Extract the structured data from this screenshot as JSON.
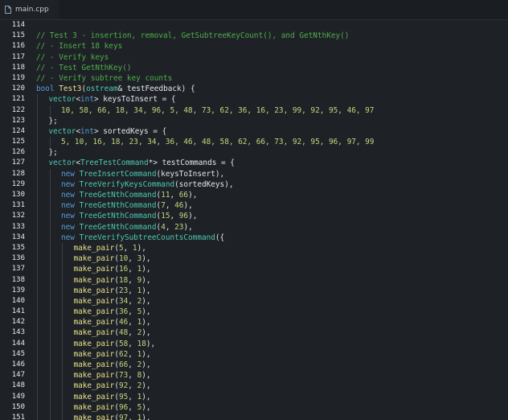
{
  "tab": {
    "label": "main.cpp",
    "icon": "file-icon"
  },
  "colors": {
    "background": "#1e2126",
    "comment": "#4fae4a",
    "keyword": "#569cd6",
    "function": "#e8e28c",
    "type": "#4ec9b0",
    "number": "#c2d87e",
    "text": "#e3e6ea"
  },
  "lines": [
    {
      "n": "114",
      "indent": 0,
      "tokens": []
    },
    {
      "n": "115",
      "indent": 0,
      "tokens": [
        {
          "t": "cm",
          "v": "// Test 3 - insertion, removal, GetSubtreeKeyCount(), and GetNthKey()"
        }
      ]
    },
    {
      "n": "116",
      "indent": 0,
      "tokens": [
        {
          "t": "cm",
          "v": "// - Insert 18 keys"
        }
      ]
    },
    {
      "n": "117",
      "indent": 0,
      "tokens": [
        {
          "t": "cm",
          "v": "// - Verify keys"
        }
      ]
    },
    {
      "n": "118",
      "indent": 0,
      "tokens": [
        {
          "t": "cm",
          "v": "// - Test GetNthKey()"
        }
      ]
    },
    {
      "n": "119",
      "indent": 0,
      "tokens": [
        {
          "t": "cm",
          "v": "// - Verify subtree key counts"
        }
      ]
    },
    {
      "n": "120",
      "indent": 0,
      "tokens": [
        {
          "t": "kw",
          "v": "bool "
        },
        {
          "t": "fn",
          "v": "Test3"
        },
        {
          "t": "pu",
          "v": "("
        },
        {
          "t": "ty",
          "v": "ostream"
        },
        {
          "t": "pu",
          "v": "& testFeedback) {"
        }
      ]
    },
    {
      "n": "121",
      "indent": 1,
      "tokens": [
        {
          "t": "ty",
          "v": "vector"
        },
        {
          "t": "pu",
          "v": "<"
        },
        {
          "t": "kw",
          "v": "int"
        },
        {
          "t": "pu",
          "v": "> keysToInsert = {"
        }
      ]
    },
    {
      "n": "122",
      "indent": 2,
      "tokens": [
        {
          "t": "nu",
          "v": "10, 58, 66, 18, 34, 96, 5, 48, 73, 62, 36, 16, 23, 99, 92, 95, 46, 97"
        }
      ]
    },
    {
      "n": "123",
      "indent": 1,
      "tokens": [
        {
          "t": "pu",
          "v": "};"
        }
      ]
    },
    {
      "n": "124",
      "indent": 1,
      "tokens": [
        {
          "t": "ty",
          "v": "vector"
        },
        {
          "t": "pu",
          "v": "<"
        },
        {
          "t": "kw",
          "v": "int"
        },
        {
          "t": "pu",
          "v": "> sortedKeys = {"
        }
      ]
    },
    {
      "n": "125",
      "indent": 2,
      "tokens": [
        {
          "t": "nu",
          "v": "5, 10, 16, 18, 23, 34, 36, 46, 48, 58, 62, 66, 73, 92, 95, 96, 97, 99"
        }
      ]
    },
    {
      "n": "126",
      "indent": 1,
      "tokens": [
        {
          "t": "pu",
          "v": "};"
        }
      ]
    },
    {
      "n": "127",
      "indent": 1,
      "tokens": [
        {
          "t": "ty",
          "v": "vector"
        },
        {
          "t": "pu",
          "v": "<"
        },
        {
          "t": "ty",
          "v": "TreeTestCommand"
        },
        {
          "t": "pu",
          "v": "*> testCommands = {"
        }
      ]
    },
    {
      "n": "128",
      "indent": 2,
      "tokens": [
        {
          "t": "kw",
          "v": "new "
        },
        {
          "t": "ty",
          "v": "TreeInsertCommand"
        },
        {
          "t": "pu",
          "v": "(keysToInsert),"
        }
      ]
    },
    {
      "n": "129",
      "indent": 2,
      "tokens": [
        {
          "t": "kw",
          "v": "new "
        },
        {
          "t": "ty",
          "v": "TreeVerifyKeysCommand"
        },
        {
          "t": "pu",
          "v": "(sortedKeys),"
        }
      ]
    },
    {
      "n": "130",
      "indent": 2,
      "tokens": [
        {
          "t": "kw",
          "v": "new "
        },
        {
          "t": "ty",
          "v": "TreeGetNthCommand"
        },
        {
          "t": "pu",
          "v": "("
        },
        {
          "t": "nu",
          "v": "11"
        },
        {
          "t": "pu",
          "v": ", "
        },
        {
          "t": "nu",
          "v": "66"
        },
        {
          "t": "pu",
          "v": "),"
        }
      ]
    },
    {
      "n": "131",
      "indent": 2,
      "tokens": [
        {
          "t": "kw",
          "v": "new "
        },
        {
          "t": "ty",
          "v": "TreeGetNthCommand"
        },
        {
          "t": "pu",
          "v": "("
        },
        {
          "t": "nu",
          "v": "7"
        },
        {
          "t": "pu",
          "v": ", "
        },
        {
          "t": "nu",
          "v": "46"
        },
        {
          "t": "pu",
          "v": "),"
        }
      ]
    },
    {
      "n": "132",
      "indent": 2,
      "tokens": [
        {
          "t": "kw",
          "v": "new "
        },
        {
          "t": "ty",
          "v": "TreeGetNthCommand"
        },
        {
          "t": "pu",
          "v": "("
        },
        {
          "t": "nu",
          "v": "15"
        },
        {
          "t": "pu",
          "v": ", "
        },
        {
          "t": "nu",
          "v": "96"
        },
        {
          "t": "pu",
          "v": "),"
        }
      ]
    },
    {
      "n": "133",
      "indent": 2,
      "tokens": [
        {
          "t": "kw",
          "v": "new "
        },
        {
          "t": "ty",
          "v": "TreeGetNthCommand"
        },
        {
          "t": "pu",
          "v": "("
        },
        {
          "t": "nu",
          "v": "4"
        },
        {
          "t": "pu",
          "v": ", "
        },
        {
          "t": "nu",
          "v": "23"
        },
        {
          "t": "pu",
          "v": "),"
        }
      ]
    },
    {
      "n": "134",
      "indent": 2,
      "tokens": [
        {
          "t": "kw",
          "v": "new "
        },
        {
          "t": "ty",
          "v": "TreeVerifySubtreeCountsCommand"
        },
        {
          "t": "pu",
          "v": "({"
        }
      ]
    },
    {
      "n": "135",
      "indent": 3,
      "tokens": [
        {
          "t": "fn",
          "v": "make_pair"
        },
        {
          "t": "pu",
          "v": "("
        },
        {
          "t": "nu",
          "v": "5"
        },
        {
          "t": "pu",
          "v": ", "
        },
        {
          "t": "nu",
          "v": "1"
        },
        {
          "t": "pu",
          "v": "),"
        }
      ]
    },
    {
      "n": "136",
      "indent": 3,
      "tokens": [
        {
          "t": "fn",
          "v": "make_pair"
        },
        {
          "t": "pu",
          "v": "("
        },
        {
          "t": "nu",
          "v": "10"
        },
        {
          "t": "pu",
          "v": ", "
        },
        {
          "t": "nu",
          "v": "3"
        },
        {
          "t": "pu",
          "v": "),"
        }
      ]
    },
    {
      "n": "137",
      "indent": 3,
      "tokens": [
        {
          "t": "fn",
          "v": "make_pair"
        },
        {
          "t": "pu",
          "v": "("
        },
        {
          "t": "nu",
          "v": "16"
        },
        {
          "t": "pu",
          "v": ", "
        },
        {
          "t": "nu",
          "v": "1"
        },
        {
          "t": "pu",
          "v": "),"
        }
      ]
    },
    {
      "n": "138",
      "indent": 3,
      "tokens": [
        {
          "t": "fn",
          "v": "make_pair"
        },
        {
          "t": "pu",
          "v": "("
        },
        {
          "t": "nu",
          "v": "18"
        },
        {
          "t": "pu",
          "v": ", "
        },
        {
          "t": "nu",
          "v": "9"
        },
        {
          "t": "pu",
          "v": "),"
        }
      ]
    },
    {
      "n": "139",
      "indent": 3,
      "tokens": [
        {
          "t": "fn",
          "v": "make_pair"
        },
        {
          "t": "pu",
          "v": "("
        },
        {
          "t": "nu",
          "v": "23"
        },
        {
          "t": "pu",
          "v": ", "
        },
        {
          "t": "nu",
          "v": "1"
        },
        {
          "t": "pu",
          "v": "),"
        }
      ]
    },
    {
      "n": "140",
      "indent": 3,
      "tokens": [
        {
          "t": "fn",
          "v": "make_pair"
        },
        {
          "t": "pu",
          "v": "("
        },
        {
          "t": "nu",
          "v": "34"
        },
        {
          "t": "pu",
          "v": ", "
        },
        {
          "t": "nu",
          "v": "2"
        },
        {
          "t": "pu",
          "v": "),"
        }
      ]
    },
    {
      "n": "141",
      "indent": 3,
      "tokens": [
        {
          "t": "fn",
          "v": "make_pair"
        },
        {
          "t": "pu",
          "v": "("
        },
        {
          "t": "nu",
          "v": "36"
        },
        {
          "t": "pu",
          "v": ", "
        },
        {
          "t": "nu",
          "v": "5"
        },
        {
          "t": "pu",
          "v": "),"
        }
      ]
    },
    {
      "n": "142",
      "indent": 3,
      "tokens": [
        {
          "t": "fn",
          "v": "make_pair"
        },
        {
          "t": "pu",
          "v": "("
        },
        {
          "t": "nu",
          "v": "46"
        },
        {
          "t": "pu",
          "v": ", "
        },
        {
          "t": "nu",
          "v": "1"
        },
        {
          "t": "pu",
          "v": "),"
        }
      ]
    },
    {
      "n": "143",
      "indent": 3,
      "tokens": [
        {
          "t": "fn",
          "v": "make_pair"
        },
        {
          "t": "pu",
          "v": "("
        },
        {
          "t": "nu",
          "v": "48"
        },
        {
          "t": "pu",
          "v": ", "
        },
        {
          "t": "nu",
          "v": "2"
        },
        {
          "t": "pu",
          "v": "),"
        }
      ]
    },
    {
      "n": "144",
      "indent": 3,
      "tokens": [
        {
          "t": "fn",
          "v": "make_pair"
        },
        {
          "t": "pu",
          "v": "("
        },
        {
          "t": "nu",
          "v": "58"
        },
        {
          "t": "pu",
          "v": ", "
        },
        {
          "t": "nu",
          "v": "18"
        },
        {
          "t": "pu",
          "v": "),"
        }
      ]
    },
    {
      "n": "145",
      "indent": 3,
      "tokens": [
        {
          "t": "fn",
          "v": "make_pair"
        },
        {
          "t": "pu",
          "v": "("
        },
        {
          "t": "nu",
          "v": "62"
        },
        {
          "t": "pu",
          "v": ", "
        },
        {
          "t": "nu",
          "v": "1"
        },
        {
          "t": "pu",
          "v": "),"
        }
      ]
    },
    {
      "n": "146",
      "indent": 3,
      "tokens": [
        {
          "t": "fn",
          "v": "make_pair"
        },
        {
          "t": "pu",
          "v": "("
        },
        {
          "t": "nu",
          "v": "66"
        },
        {
          "t": "pu",
          "v": ", "
        },
        {
          "t": "nu",
          "v": "2"
        },
        {
          "t": "pu",
          "v": "),"
        }
      ]
    },
    {
      "n": "147",
      "indent": 3,
      "tokens": [
        {
          "t": "fn",
          "v": "make_pair"
        },
        {
          "t": "pu",
          "v": "("
        },
        {
          "t": "nu",
          "v": "73"
        },
        {
          "t": "pu",
          "v": ", "
        },
        {
          "t": "nu",
          "v": "8"
        },
        {
          "t": "pu",
          "v": "),"
        }
      ]
    },
    {
      "n": "148",
      "indent": 3,
      "tokens": [
        {
          "t": "fn",
          "v": "make_pair"
        },
        {
          "t": "pu",
          "v": "("
        },
        {
          "t": "nu",
          "v": "92"
        },
        {
          "t": "pu",
          "v": ", "
        },
        {
          "t": "nu",
          "v": "2"
        },
        {
          "t": "pu",
          "v": "),"
        }
      ]
    },
    {
      "n": "149",
      "indent": 3,
      "tokens": [
        {
          "t": "fn",
          "v": "make_pair"
        },
        {
          "t": "pu",
          "v": "("
        },
        {
          "t": "nu",
          "v": "95"
        },
        {
          "t": "pu",
          "v": ", "
        },
        {
          "t": "nu",
          "v": "1"
        },
        {
          "t": "pu",
          "v": "),"
        }
      ]
    },
    {
      "n": "150",
      "indent": 3,
      "tokens": [
        {
          "t": "fn",
          "v": "make_pair"
        },
        {
          "t": "pu",
          "v": "("
        },
        {
          "t": "nu",
          "v": "96"
        },
        {
          "t": "pu",
          "v": ", "
        },
        {
          "t": "nu",
          "v": "5"
        },
        {
          "t": "pu",
          "v": "),"
        }
      ]
    },
    {
      "n": "151",
      "indent": 3,
      "tokens": [
        {
          "t": "fn",
          "v": "make_pair"
        },
        {
          "t": "pu",
          "v": "("
        },
        {
          "t": "nu",
          "v": "97"
        },
        {
          "t": "pu",
          "v": ", "
        },
        {
          "t": "nu",
          "v": "1"
        },
        {
          "t": "pu",
          "v": "),"
        }
      ]
    }
  ]
}
